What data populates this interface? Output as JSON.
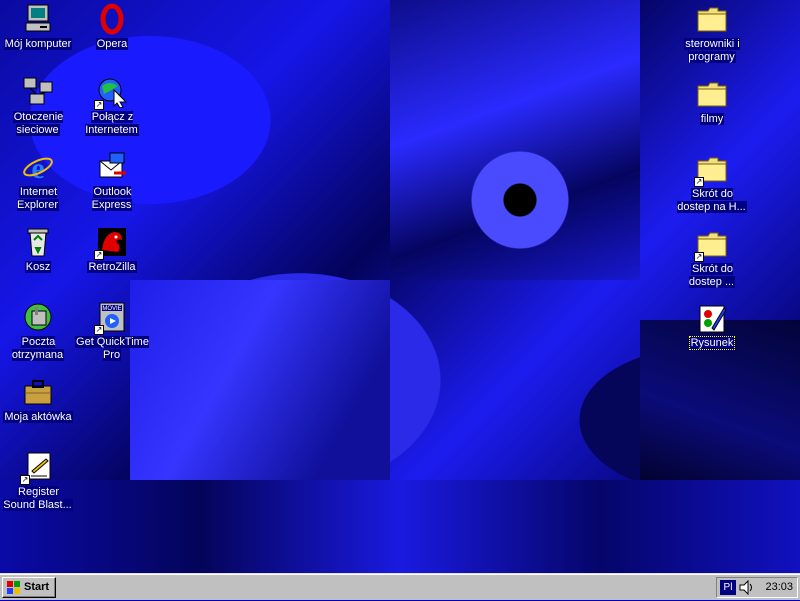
{
  "desktop": {
    "left_icons": [
      {
        "label": "Mój komputer",
        "icon": "my-computer-icon"
      },
      {
        "label": "Opera",
        "icon": "opera-icon"
      },
      {
        "label": "Otoczenie sieciowe",
        "icon": "network-neighborhood-icon"
      },
      {
        "label": "Połącz z Internetem",
        "icon": "connect-internet-icon"
      },
      {
        "label": "Internet Explorer",
        "icon": "internet-explorer-icon"
      },
      {
        "label": "Outlook Express",
        "icon": "outlook-express-icon"
      },
      {
        "label": "Kosz",
        "icon": "recycle-bin-icon"
      },
      {
        "label": "RetroZilla",
        "icon": "retrozilla-icon"
      },
      {
        "label": "Poczta otrzymana",
        "icon": "inbox-icon"
      },
      {
        "label": "Get QuickTime Pro",
        "icon": "quicktime-icon"
      },
      {
        "label": "Moja aktówka",
        "icon": "briefcase-icon"
      },
      {
        "label": "Register Sound Blast...",
        "icon": "register-icon"
      }
    ],
    "right_icons": [
      {
        "label": "sterowniki i programy",
        "icon": "folder-icon"
      },
      {
        "label": "filmy",
        "icon": "folder-icon"
      },
      {
        "label": "Skrót do dostep na H...",
        "icon": "folder-shortcut-icon"
      },
      {
        "label": "Skrót do dostep ...",
        "icon": "folder-shortcut-icon"
      },
      {
        "label": "Rysunek",
        "icon": "paint-icon"
      }
    ]
  },
  "taskbar": {
    "start_label": "Start",
    "language": "Pl",
    "clock": "23:03"
  },
  "colors": {
    "desktop_blue": "#0000c8",
    "taskbar_gray": "#c0c0c0",
    "label_bg": "#000080"
  }
}
